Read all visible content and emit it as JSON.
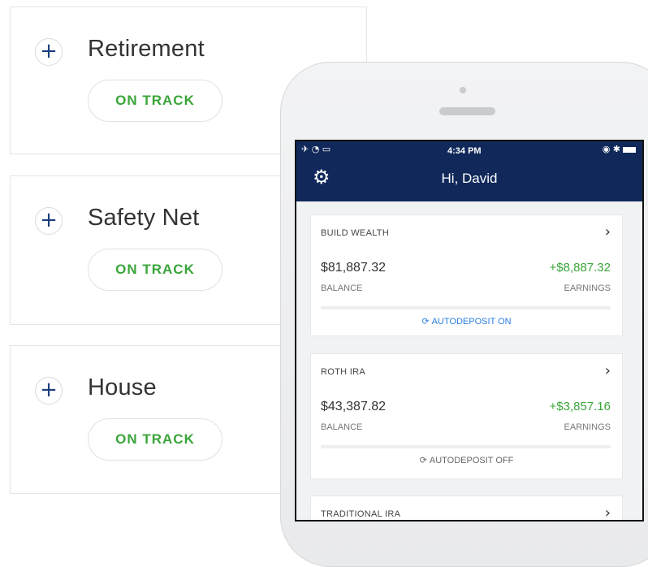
{
  "goals": [
    {
      "title": "Retirement",
      "status": "ON TRACK"
    },
    {
      "title": "Safety Net",
      "status": "ON TRACK"
    },
    {
      "title": "House",
      "status": "ON TRACK"
    }
  ],
  "phone": {
    "status_bar": {
      "time": "4:34 PM"
    },
    "greeting": "Hi, David",
    "accounts": [
      {
        "name": "BUILD WEALTH",
        "balance": "$81,887.32",
        "balance_label": "BALANCE",
        "earnings": "+$8,887.32",
        "earnings_label": "EARNINGS",
        "autodeposit": "AUTODEPOSIT ON"
      },
      {
        "name": "ROTH IRA",
        "balance": "$43,387.82",
        "balance_label": "BALANCE",
        "earnings": "+$3,857.16",
        "earnings_label": "EARNINGS",
        "autodeposit": "AUTODEPOSIT OFF"
      },
      {
        "name": "TRADITIONAL IRA"
      }
    ]
  },
  "icons": {
    "plus": "+",
    "gear": "⚙",
    "chevron": "›",
    "refresh": "⟳"
  },
  "colors": {
    "on_track": "#3aa53a",
    "header_bg": "#10295a",
    "earnings": "#3aa53a",
    "autodeposit_on": "#2a7de1"
  }
}
